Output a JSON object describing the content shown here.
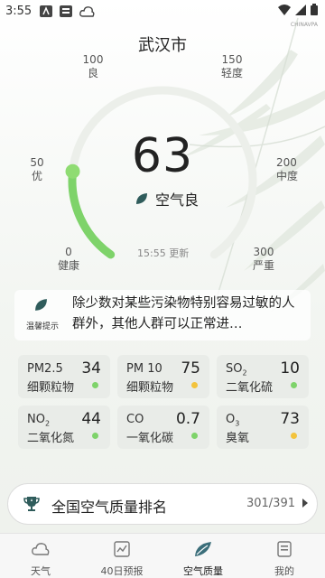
{
  "status_bar": {
    "time": "3:55",
    "small_text": "CHINAVPA"
  },
  "city": "武汉市",
  "scale": {
    "v0": "0",
    "l0": "健康",
    "v50": "50",
    "l50": "优",
    "v100": "100",
    "l100": "良",
    "v150": "150",
    "l150": "轻度",
    "v200": "200",
    "l200": "中度",
    "v300": "300",
    "l300": "严重"
  },
  "aqi": {
    "value": "63",
    "level": "空气良",
    "fraction_of_300": 0.21,
    "update": "15:55 更新"
  },
  "tip": {
    "label": "温馨提示",
    "text": "除少数对某些污染物特别容易过敏的人群外，其他人群可以正常进…"
  },
  "pollutants": [
    {
      "name": "PM2.5",
      "sub": "",
      "value": "34",
      "desc": "细颗粒物",
      "dot_color": "#7ed36a"
    },
    {
      "name": "PM 10",
      "sub": "",
      "value": "75",
      "desc": "细颗粒物",
      "dot_color": "#f3c33c"
    },
    {
      "name": "SO",
      "sub": "2",
      "value": "10",
      "desc": "二氧化硫",
      "dot_color": "#7ed36a"
    },
    {
      "name": "NO",
      "sub": "2",
      "value": "44",
      "desc": "二氧化氮",
      "dot_color": "#7ed36a"
    },
    {
      "name": "CO",
      "sub": "",
      "value": "0.7",
      "desc": "一氧化碳",
      "dot_color": "#7ed36a"
    },
    {
      "name": "O",
      "sub": "3",
      "value": "73",
      "desc": "臭氧",
      "dot_color": "#f3c33c"
    }
  ],
  "ranking": {
    "label": "全国空气质量排名",
    "value": "301/391"
  },
  "tabs": [
    {
      "label": "天气",
      "icon": "cloud-icon"
    },
    {
      "label": "40日预报",
      "icon": "chart-icon"
    },
    {
      "label": "空气质量",
      "icon": "leaf-icon"
    },
    {
      "label": "我的",
      "icon": "profile-icon"
    }
  ],
  "colors": {
    "accent_green": "#7ed36a",
    "warn_yellow": "#f3c33c",
    "tab_active": "#3b6e7a"
  }
}
